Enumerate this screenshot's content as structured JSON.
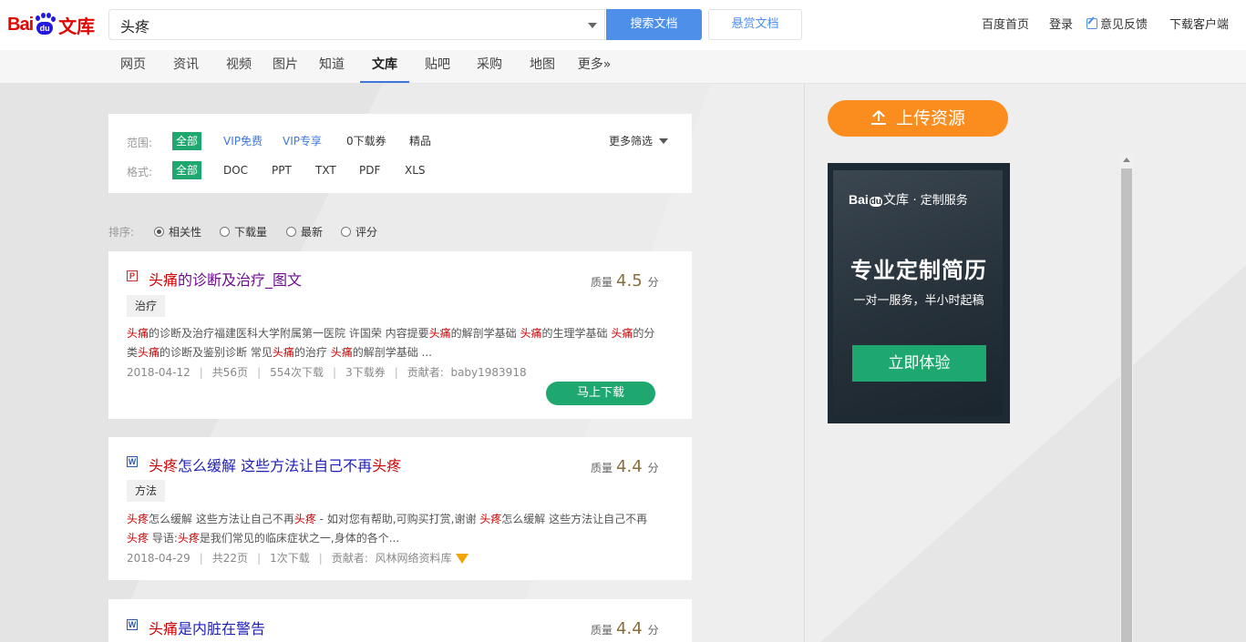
{
  "header": {
    "logo_left": "Bai",
    "logo_paw": "du",
    "logo_right": "文库",
    "search_value": "头疼",
    "search_button": "搜索文档",
    "reward_button": "悬赏文档",
    "links": [
      "百度首页",
      "登录",
      "意见反馈",
      "下载客户端"
    ]
  },
  "nav_tabs": [
    "网页",
    "资讯",
    "视频",
    "图片",
    "知道",
    "文库",
    "贴吧",
    "采购",
    "地图",
    "更多»"
  ],
  "active_tab": "文库",
  "filters": {
    "scope_label": "范围:",
    "scope_options": [
      "全部",
      "VIP免费",
      "VIP专享",
      "0下载券",
      "精品"
    ],
    "format_label": "格式:",
    "format_options": [
      "全部",
      "DOC",
      "PPT",
      "TXT",
      "PDF",
      "XLS"
    ],
    "more_filters": "更多筛选"
  },
  "sort": {
    "label": "排序:",
    "options": [
      "相关性",
      "下载量",
      "最新",
      "评分"
    ],
    "selected": "相关性"
  },
  "results": [
    {
      "file_type": "P",
      "title_highlight": "头痛",
      "title_rest": "的诊断及治疗_图文",
      "quality_label": "质量",
      "quality_score": "4.5",
      "quality_unit": "分",
      "tag": "治疗",
      "snippet_line1": [
        {
          "hl": "头痛"
        },
        {
          "t": "的诊断及治疗福建医科大学附属第一医院 许国荣 内容提要"
        },
        {
          "hl": "头痛"
        },
        {
          "t": "的解剖学基础 "
        },
        {
          "hl": "头痛"
        },
        {
          "t": "的生理学基础 "
        },
        {
          "hl": "头痛"
        },
        {
          "t": "的分"
        }
      ],
      "snippet_line2": [
        {
          "t": "类"
        },
        {
          "hl": "头痛"
        },
        {
          "t": "的诊断及鉴别诊断 常见"
        },
        {
          "hl": "头痛"
        },
        {
          "t": "的治疗 "
        },
        {
          "hl": "头痛"
        },
        {
          "t": "的解剖学基础 ..."
        }
      ],
      "date": "2018-04-12",
      "pages": "共56页",
      "downloads": "554次下载",
      "coupons": "3下载券",
      "contributor_label": "贡献者:",
      "contributor": "baby1983918",
      "download_button": "马上下载"
    },
    {
      "file_type": "W",
      "title_highlight": "头疼",
      "title_rest": "怎么缓解 这些方法让自己不再",
      "title_highlight2": "头疼",
      "quality_label": "质量",
      "quality_score": "4.4",
      "quality_unit": "分",
      "tag": "方法",
      "snippet_line1": [
        {
          "hl": "头疼"
        },
        {
          "t": "怎么缓解 这些方法让自己不再"
        },
        {
          "hl": "头疼"
        },
        {
          "t": " - 如对您有帮助,可购买打赏,谢谢 "
        },
        {
          "hl": "头疼"
        },
        {
          "t": "怎么缓解 这些方法让自己不再"
        }
      ],
      "snippet_line2": [
        {
          "hl": "头疼"
        },
        {
          "t": " 导语:"
        },
        {
          "hl": "头疼"
        },
        {
          "t": "是我们常见的临床症状之一,身体的各个..."
        }
      ],
      "date": "2018-04-29",
      "pages": "共22页",
      "downloads": "1次下载",
      "contributor_label": "贡献者:",
      "contributor": "风林网络资料库"
    },
    {
      "file_type": "W",
      "title_highlight": "头痛",
      "title_rest": "是内脏在警告",
      "quality_label": "质量",
      "quality_score": "4.4",
      "quality_unit": "分"
    }
  ],
  "sidebar": {
    "upload_button": "上传资源",
    "ad": {
      "logo_en": "Bai",
      "logo_paw": "du",
      "logo_cn": "文库",
      "logo_service": "· 定制服务",
      "headline": "专业定制简历",
      "subline": "一对一服务，半小时起稿",
      "button": "立即体验"
    }
  },
  "colors": {
    "brand_red": "#e10601",
    "search_blue": "#4e8fea",
    "green": "#1ea86f",
    "orange": "#fb8d1e",
    "highlight_red": "#cc0000"
  }
}
